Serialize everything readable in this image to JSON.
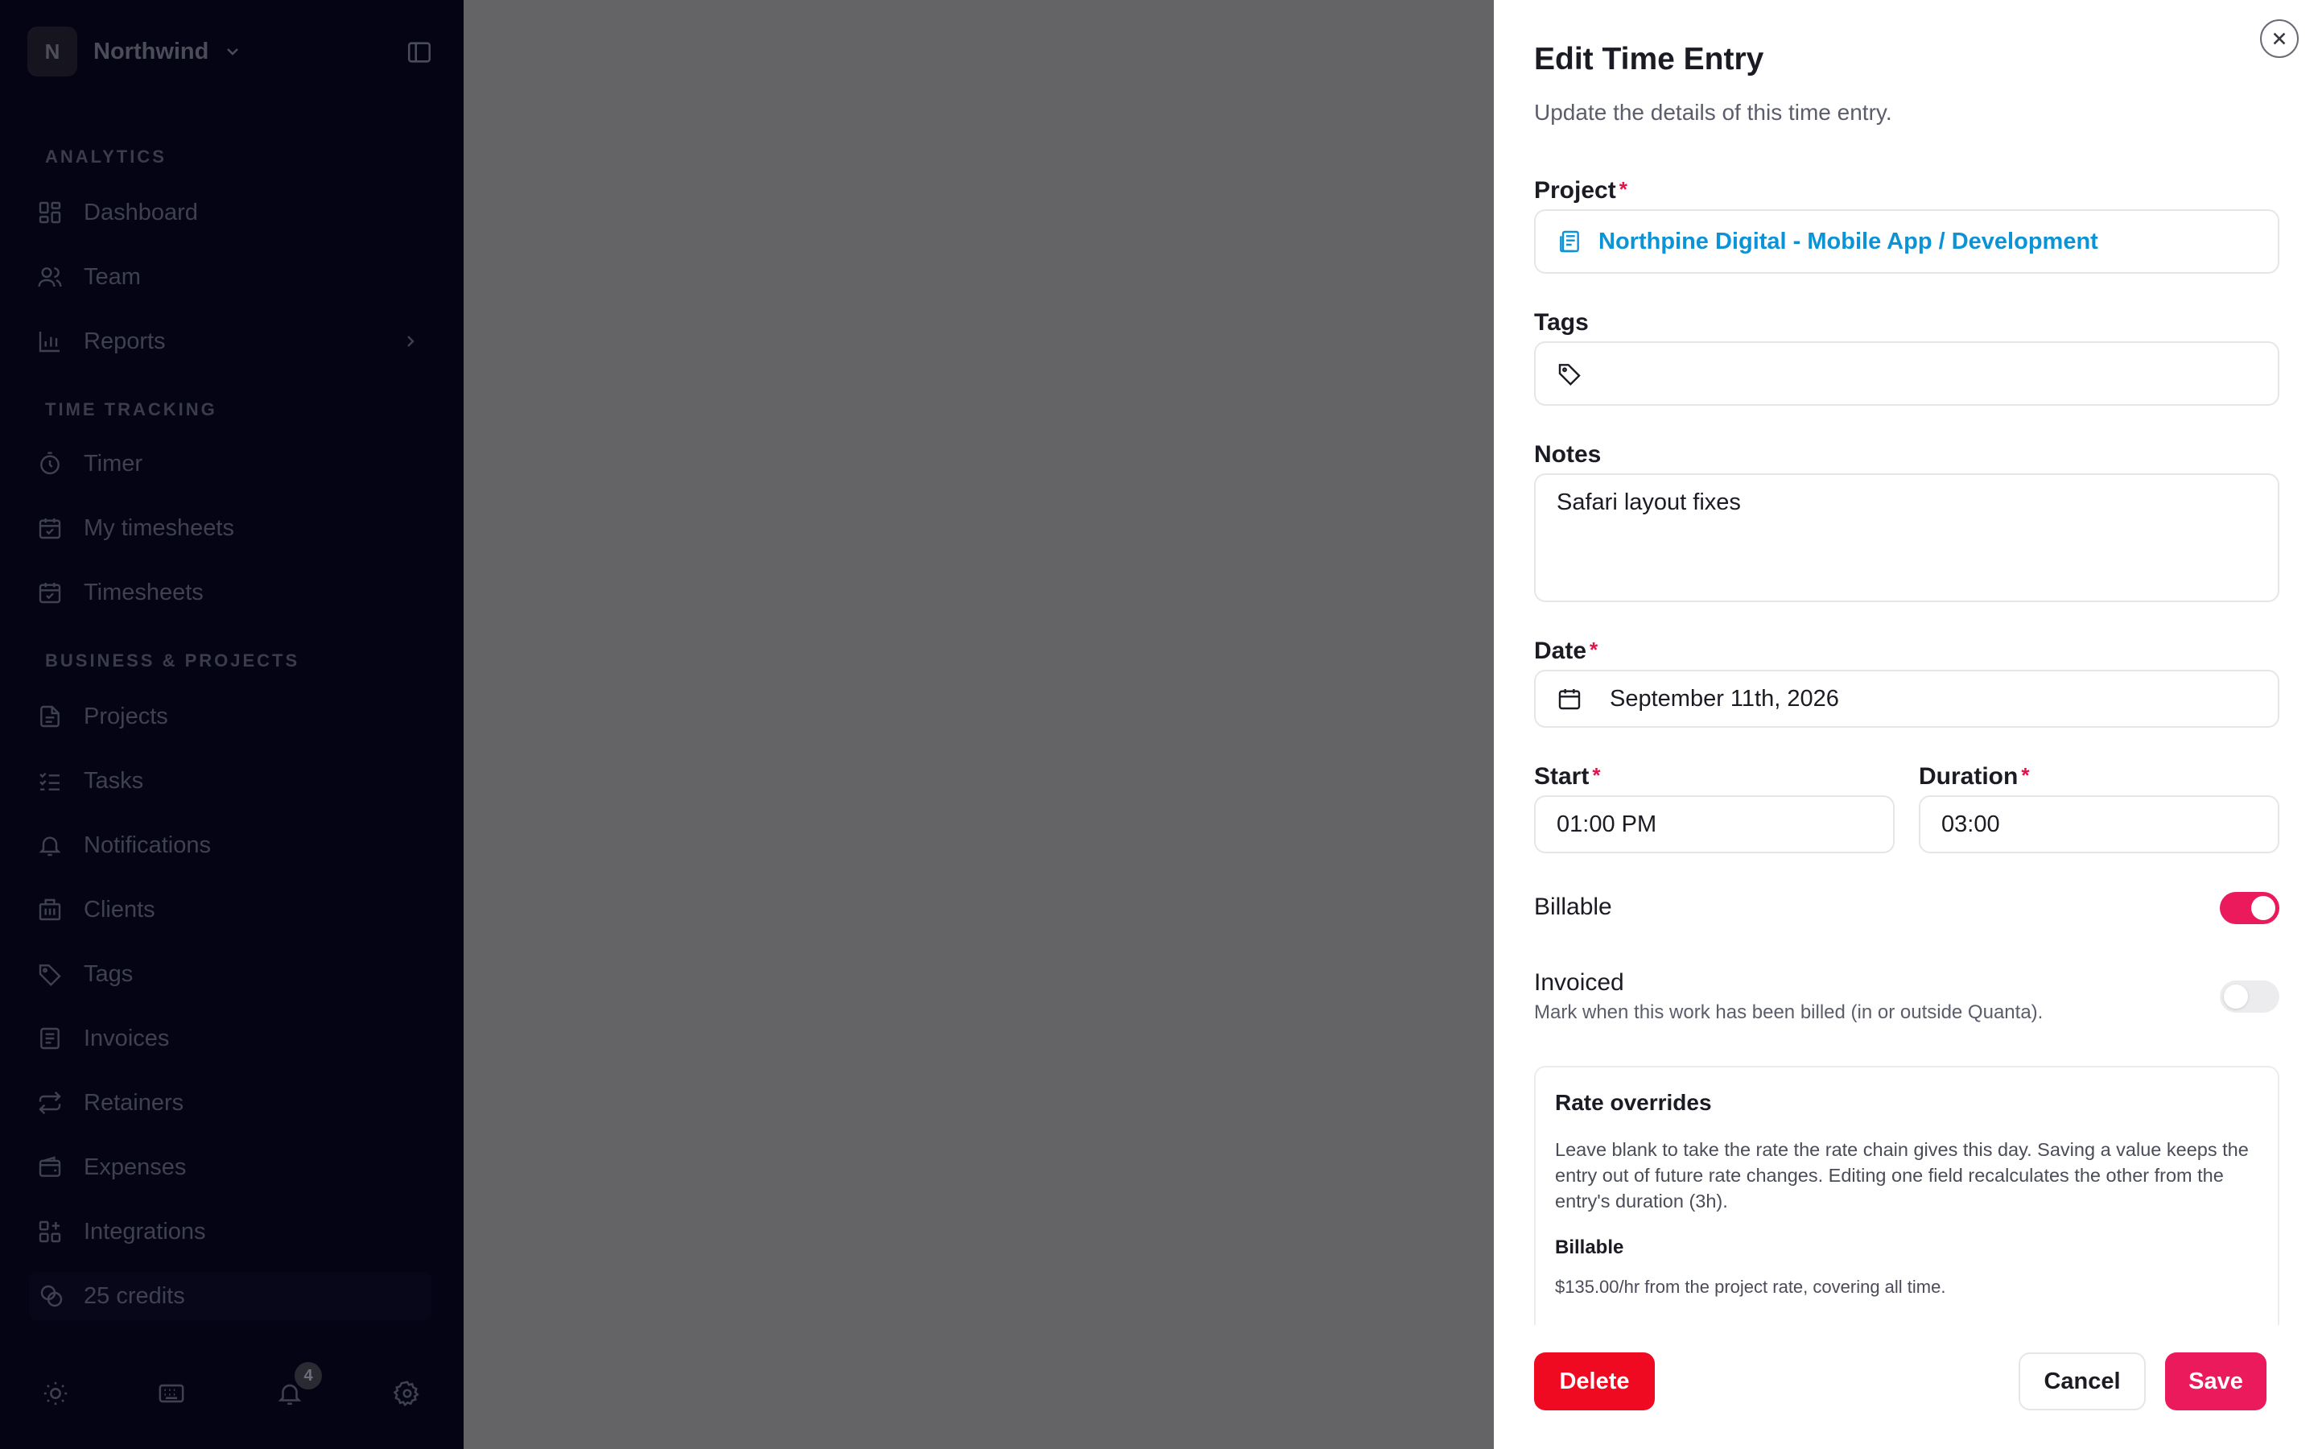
{
  "workspace": {
    "initial": "N",
    "name": "Northwind"
  },
  "sidebar": {
    "sections": [
      {
        "label": "ANALYTICS"
      },
      {
        "label": "TIME TRACKING"
      },
      {
        "label": "BUSINESS & PROJECTS"
      }
    ],
    "items": [
      {
        "label": "Dashboard",
        "icon": "dashboard-icon"
      },
      {
        "label": "Team",
        "icon": "team-icon"
      },
      {
        "label": "Reports",
        "icon": "reports-icon"
      },
      {
        "label": "Timer",
        "icon": "timer-icon"
      },
      {
        "label": "My timesheets",
        "icon": "calendar-check-icon"
      },
      {
        "label": "Timesheets",
        "icon": "calendar-check-icon"
      },
      {
        "label": "Projects",
        "icon": "document-icon"
      },
      {
        "label": "Tasks",
        "icon": "checklist-icon"
      },
      {
        "label": "Notifications",
        "icon": "bell-icon"
      },
      {
        "label": "Clients",
        "icon": "building-icon"
      },
      {
        "label": "Tags",
        "icon": "tag-icon"
      },
      {
        "label": "Invoices",
        "icon": "invoice-icon"
      },
      {
        "label": "Retainers",
        "icon": "repeat-icon"
      },
      {
        "label": "Expenses",
        "icon": "wallet-icon"
      },
      {
        "label": "Integrations",
        "icon": "integrations-icon"
      }
    ],
    "credits": "25 credits",
    "notification_count": "4"
  },
  "drawer": {
    "title": "Edit Time Entry",
    "subtitle": "Update the details of this time entry.",
    "project_label": "Project",
    "project_value": "Northpine Digital - Mobile App / Development",
    "tags_label": "Tags",
    "notes_label": "Notes",
    "notes_value": "Safari layout fixes",
    "date_label": "Date",
    "date_value": "September 11th, 2026",
    "start_label": "Start",
    "start_value": "01:00 PM",
    "duration_label": "Duration",
    "duration_value": "03:00",
    "billable_label": "Billable",
    "billable_on": true,
    "invoiced_label": "Invoiced",
    "invoiced_help": "Mark when this work has been billed (in or outside Quanta).",
    "invoiced_on": false,
    "rate": {
      "title": "Rate overrides",
      "description": "Leave blank to take the rate the rate chain gives this day. Saving a value keeps the entry out of future rate changes. Editing one field recalculates the other from the entry's duration (3h).",
      "billable_heading": "Billable",
      "billable_info": "$135.00/hr from the project rate, covering all time."
    },
    "delete_label": "Delete",
    "cancel_label": "Cancel",
    "save_label": "Save"
  },
  "colors": {
    "accent": "#ea1a5d",
    "danger": "#ef0a22",
    "link": "#0c93d6"
  }
}
